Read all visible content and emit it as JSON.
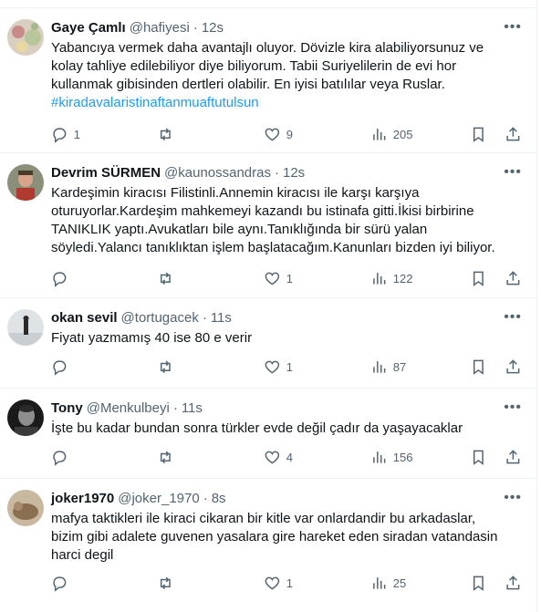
{
  "tweets": [
    {
      "name": "Gaye Çamlı",
      "handle": "@hafiyesi",
      "time": "12s",
      "lines": [
        "Yabancıya vermek daha avantajlı oluyor. Dövizle kira alabiliyorsunuz ve",
        "kolay tahliye edilebiliyor diye biliyorum. Tabii Suriyelilerin de evi hor",
        "kullanmak gibisinden dertleri olabilir. En iyisi batılılar veya Ruslar."
      ],
      "hashtag": "#kiradavalaristinaftanmuaftutulsun",
      "replies": "1",
      "retweets": "",
      "likes": "9",
      "views": "205",
      "avatar_icon": "floral-avatar"
    },
    {
      "name": "Devrim SÜRMEN",
      "handle": "@kaunossandras",
      "time": "12s",
      "lines": [
        "Kardeşimin kiracısı Filistinli.Annemin kiracısı ile karşı karşıya",
        "oturuyorlar.Kardeşim mahkemeyi kazandı bu istinafa gitti.İkisi birbirine",
        "TANIKLIK yaptı.Avukatları bile aynı.Tanıklığında bir sürü yalan",
        "söyledi.Yalancı tanıklıktan işlem başlatacağım.Kanunları bizden iyi biliyor."
      ],
      "replies": "",
      "retweets": "",
      "likes": "1",
      "views": "122",
      "avatar_icon": "portrait-avatar"
    },
    {
      "name": "okan sevil",
      "handle": "@tortugacek",
      "time": "11s",
      "lines": [
        "Fiyatı yazmamış 40 ise 80 e verir"
      ],
      "replies": "",
      "retweets": "",
      "likes": "1",
      "views": "87",
      "avatar_icon": "snow-figure-avatar"
    },
    {
      "name": "Tony",
      "handle": "@Menkulbeyi",
      "time": "11s",
      "lines": [
        "İşte bu kadar bundan sonra türkler evde değil çadır da yaşayacaklar"
      ],
      "replies": "",
      "retweets": "",
      "likes": "4",
      "views": "156",
      "avatar_icon": "bw-portrait-avatar"
    },
    {
      "name": "joker1970",
      "handle": "@joker_1970",
      "time": "8s",
      "lines": [
        "mafya taktikleri ile kiraci cikaran bir kitle var onlardandir bu arkadaslar,",
        "bizim gibi adalete guvenen yasalara gire hareket eden siradan vatandasin",
        "harci degil"
      ],
      "replies": "",
      "retweets": "",
      "likes": "1",
      "views": "25",
      "avatar_icon": "animal-avatar"
    }
  ],
  "colors": {
    "text": "#0f1419",
    "muted": "#536471",
    "link": "#1d9bf0",
    "border": "#eff3f4"
  }
}
